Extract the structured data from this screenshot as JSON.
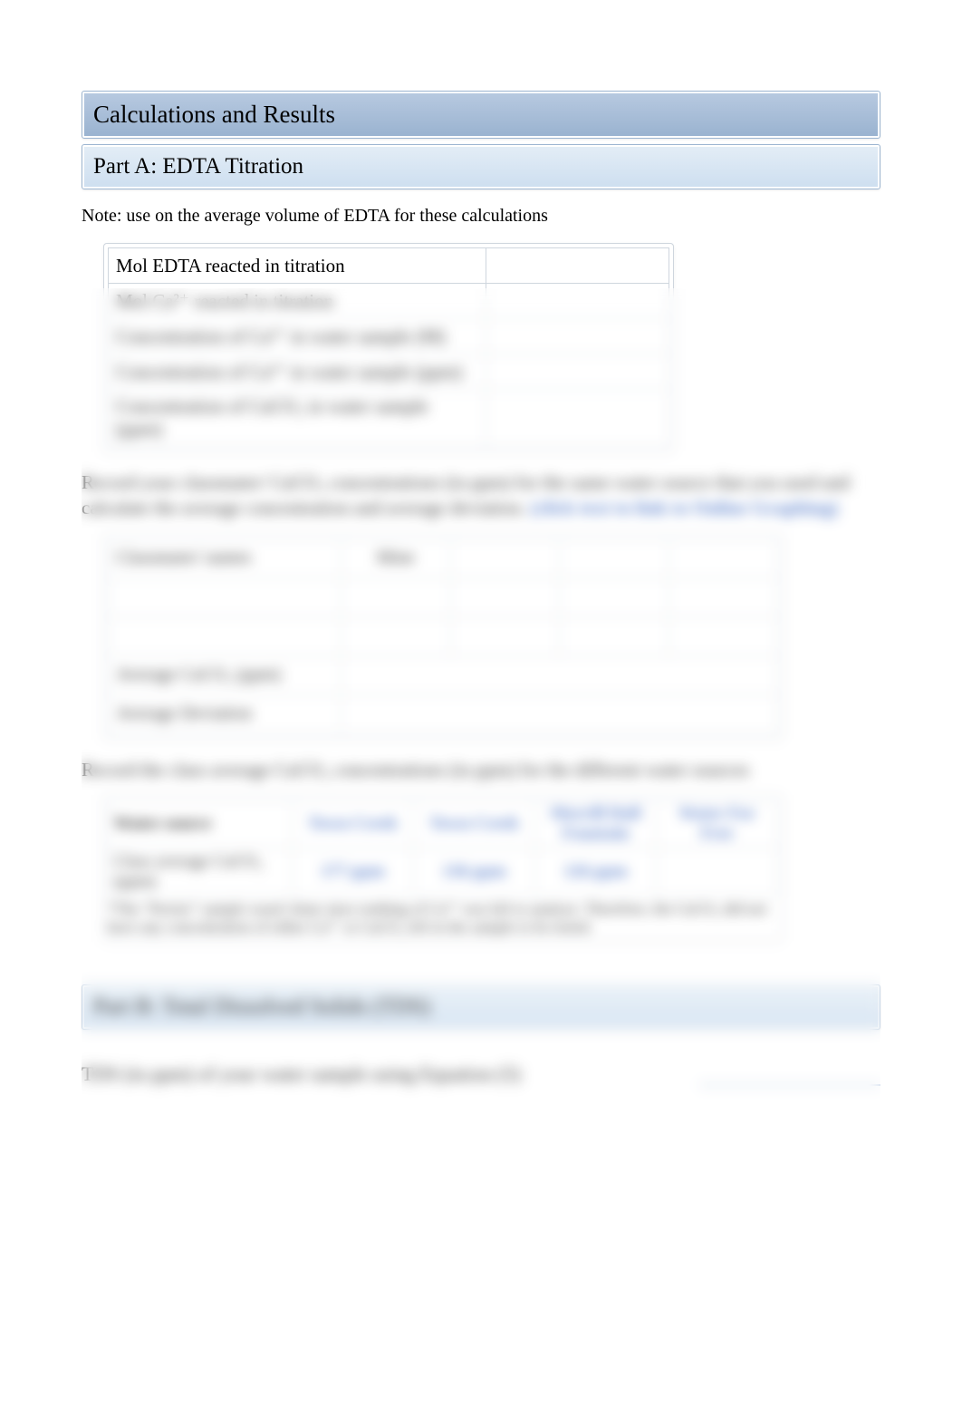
{
  "headings": {
    "h1": "Calculations and Results",
    "h2a": "Part A: EDTA Titration",
    "h2b": "Part B: Total Dissolved Solids (TDS)"
  },
  "note": "Note: use on the average volume of EDTA for these calculations",
  "table1": {
    "rows": [
      "Mol EDTA reacted in titration",
      "Mol Ca²⁺ reacted in titration",
      "Concentration of Ca²⁺ in water sample (M)",
      "Concentration of Ca²⁺ in water sample (ppm)",
      "Concentration of CaCO₃ in water sample (ppm)"
    ]
  },
  "para1_a": "Record your classmates' CaCO₃ concentrations (in ppm) for the same water source that you used and calculate the average concentration and average deviation. ",
  "para1_b": "(click text to link to Online Graphing)",
  "table2": {
    "headers": [
      "Classmates' names",
      "Mine",
      "",
      "",
      ""
    ],
    "rows": [
      [
        "",
        "",
        "",
        "",
        ""
      ],
      [
        "",
        "",
        "",
        "",
        ""
      ]
    ],
    "avg_label": "Average CaCO₃ (ppm)",
    "avg_value": "",
    "dev_label": "Average Deviation",
    "dev_value": ""
  },
  "para2": "Record the class average CaCO₃ concentrations (in ppm) for the different water sources",
  "table3": {
    "row_header": "Water source",
    "sources": [
      "Town Creek",
      "Town Creek",
      "Morrill Hall Fountain",
      "Water For Free"
    ],
    "row2_label": "Class average CaCO₃ (ppm)",
    "row2_values": [
      "177 ppm",
      "136 ppm",
      "126 ppm",
      ""
    ],
    "footnote": "*The \"Perrier\" sample wasn't done since nothing of Ca²⁺ was left to analyze. Therefore, the CaCO₃ did not have any concentration of either Ca²⁺ or CaCO₃ left in the sample to be tested."
  },
  "tds": {
    "label": "TDS (in ppm) of your water sample using Equation (5)"
  }
}
